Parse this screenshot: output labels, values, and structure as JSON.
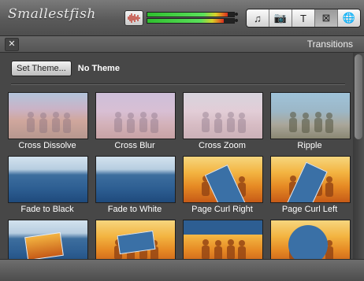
{
  "app": {
    "logo_text": "Smallestfish"
  },
  "toolbar": {
    "audio_meter_levels": [
      0.93,
      0.88
    ],
    "mode_buttons": [
      {
        "name": "music-note-icon",
        "glyph": "♫",
        "active": false
      },
      {
        "name": "camera-icon",
        "glyph": "📷",
        "active": false
      },
      {
        "name": "title-text-icon",
        "glyph": "T",
        "active": false
      },
      {
        "name": "transitions-icon",
        "glyph": "⊠",
        "active": true
      },
      {
        "name": "globe-icon",
        "glyph": "🌐",
        "active": false
      }
    ]
  },
  "panel": {
    "close_glyph": "✕",
    "title": "Transitions",
    "set_theme_label": "Set Theme...",
    "theme_name": "No Theme"
  },
  "transitions": [
    {
      "label": "Cross Dissolve",
      "scene": "blend"
    },
    {
      "label": "Cross Blur",
      "scene": "blur"
    },
    {
      "label": "Cross Zoom",
      "scene": "zoom"
    },
    {
      "label": "Ripple",
      "scene": "ripple"
    },
    {
      "label": "Fade to Black",
      "scene": "lake"
    },
    {
      "label": "Fade to White",
      "scene": "lake"
    },
    {
      "label": "Page Curl Right",
      "scene": "sunset-curl-right"
    },
    {
      "label": "Page Curl Left",
      "scene": "sunset-curl-left"
    },
    {
      "label": "",
      "scene": "lake-inset"
    },
    {
      "label": "",
      "scene": "sunset-inset"
    },
    {
      "label": "",
      "scene": "sunset-reveal"
    },
    {
      "label": "",
      "scene": "sunset-circle"
    }
  ],
  "colors": {
    "meter_green": "#2fbf2f",
    "meter_red": "#d92d1f",
    "panel_bg": "#474747"
  }
}
